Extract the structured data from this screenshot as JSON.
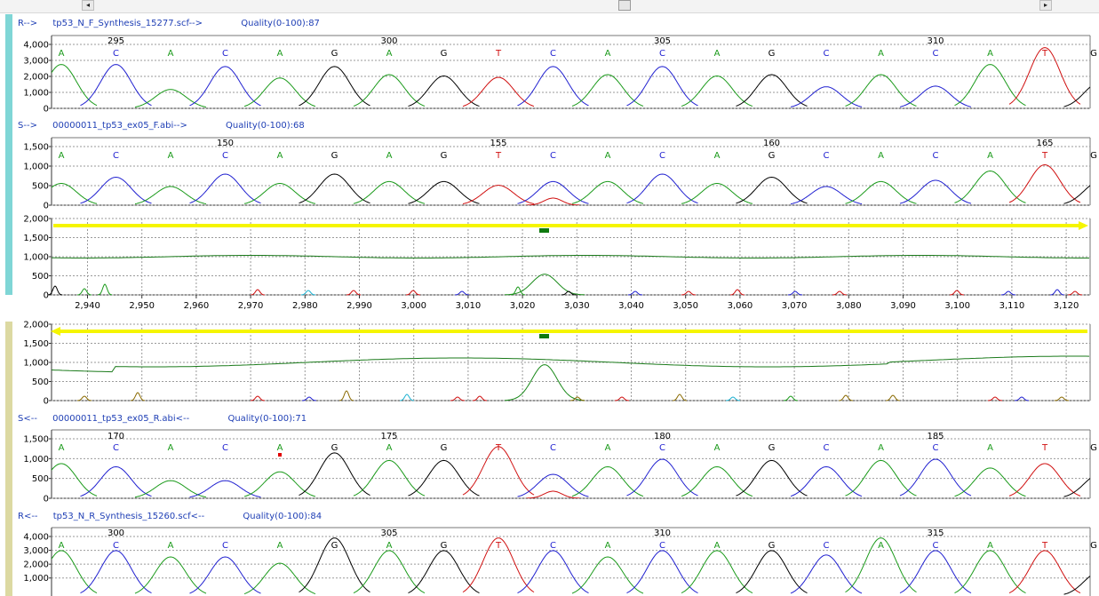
{
  "scrollbar": {
    "left_arrow": "◂",
    "right_arrow": "▸"
  },
  "colors": {
    "A": "#1a9a1a",
    "C": "#2020d0",
    "G": "#000000",
    "T": "#d01010",
    "group_forward": "#7fd6d6",
    "group_reverse": "#dcd9a2",
    "label": "#1f3fb5",
    "yellow": "#f5f500",
    "dark_green": "#0f7a0f"
  },
  "tracks": [
    {
      "id": "r-forward",
      "direction": "R-->",
      "filename": "tp53_N_F_Synthesis_15277.scf-->",
      "quality": "Quality(0-100):87",
      "yticks": [
        "4,000",
        "3,000",
        "2,000",
        "1,000",
        "0"
      ],
      "positions": [
        {
          "label": "295",
          "index": 1
        },
        {
          "label": "300",
          "index": 6
        },
        {
          "label": "305",
          "index": 11
        },
        {
          "label": "310",
          "index": 16
        }
      ],
      "bases": "CACAGAGTCACAGCACAT",
      "peaks": [
        0.65,
        0.65,
        0.28,
        0.62,
        0.45,
        0.62,
        0.5,
        0.48,
        0.46,
        0.62,
        0.5,
        0.62,
        0.48,
        0.5,
        0.32,
        0.5,
        0.33,
        0.65,
        0.9
      ]
    },
    {
      "id": "s-forward",
      "direction": "S-->",
      "filename": "00000011_tp53_ex05_F.abi-->",
      "quality": "Quality(0-100):68",
      "yticks": [
        "1,500",
        "1,000",
        "500",
        "0"
      ],
      "positions": [
        {
          "label": "150",
          "index": 3
        },
        {
          "label": "155",
          "index": 8
        },
        {
          "label": "160",
          "index": 13
        },
        {
          "label": "165",
          "index": 18
        }
      ],
      "bases": "CACAGAGTCACAGCACAT",
      "peaks": [
        0.35,
        0.45,
        0.3,
        0.5,
        0.35,
        0.5,
        0.38,
        0.38,
        0.32,
        0.38,
        0.38,
        0.5,
        0.35,
        0.45,
        0.3,
        0.38,
        0.4,
        0.55,
        0.65
      ]
    },
    {
      "id": "s-reverse",
      "direction": "S<--",
      "filename": "00000011_tp53_ex05_R.abi<--",
      "quality": "Quality(0-100):71",
      "yticks": [
        "1,500",
        "1,000",
        "500",
        "0"
      ],
      "positions": [
        {
          "label": "170",
          "index": 1
        },
        {
          "label": "175",
          "index": 6
        },
        {
          "label": "180",
          "index": 11
        },
        {
          "label": "185",
          "index": 16
        }
      ],
      "bases": "CACAGAGTCACAGCACAT",
      "peaks": [
        0.55,
        0.5,
        0.28,
        0.28,
        0.42,
        0.72,
        0.6,
        0.6,
        0.82,
        0.38,
        0.5,
        0.62,
        0.5,
        0.6,
        0.5,
        0.6,
        0.62,
        0.48,
        0.55
      ]
    },
    {
      "id": "r-reverse",
      "direction": "R<--",
      "filename": "tp53_N_R_Synthesis_15260.scf<--",
      "quality": "Quality(0-100):84",
      "yticks": [
        "4,000",
        "3,000",
        "2,000",
        "1,000"
      ],
      "positions": [
        {
          "label": "300",
          "index": 1
        },
        {
          "label": "305",
          "index": 6
        },
        {
          "label": "310",
          "index": 11
        },
        {
          "label": "315",
          "index": 16
        }
      ],
      "bases": "CACAGAGTCACAGCACAT",
      "peaks": [
        0.72,
        0.72,
        0.62,
        0.62,
        0.52,
        0.92,
        0.72,
        0.72,
        0.92,
        0.72,
        0.62,
        0.72,
        0.72,
        0.72,
        0.65,
        0.92,
        0.72,
        0.72,
        0.72
      ]
    }
  ],
  "first_base": "A",
  "last_base": "G",
  "overview_top": {
    "yticks": [
      "2,000",
      "1,500",
      "1,000",
      "500",
      "0"
    ],
    "xticks": [
      "2,940",
      "2,950",
      "2,960",
      "2,970",
      "2,980",
      "2,990",
      "3,000",
      "3,010",
      "3,020",
      "3,030",
      "3,040",
      "3,050",
      "3,060",
      "3,070",
      "3,080",
      "3,090",
      "3,100",
      "3,110",
      "3,120"
    ],
    "arrow_direction": "right"
  },
  "overview_bottom": {
    "yticks": [
      "2,000",
      "1,500",
      "1,000",
      "500",
      "0"
    ],
    "arrow_direction": "left"
  }
}
